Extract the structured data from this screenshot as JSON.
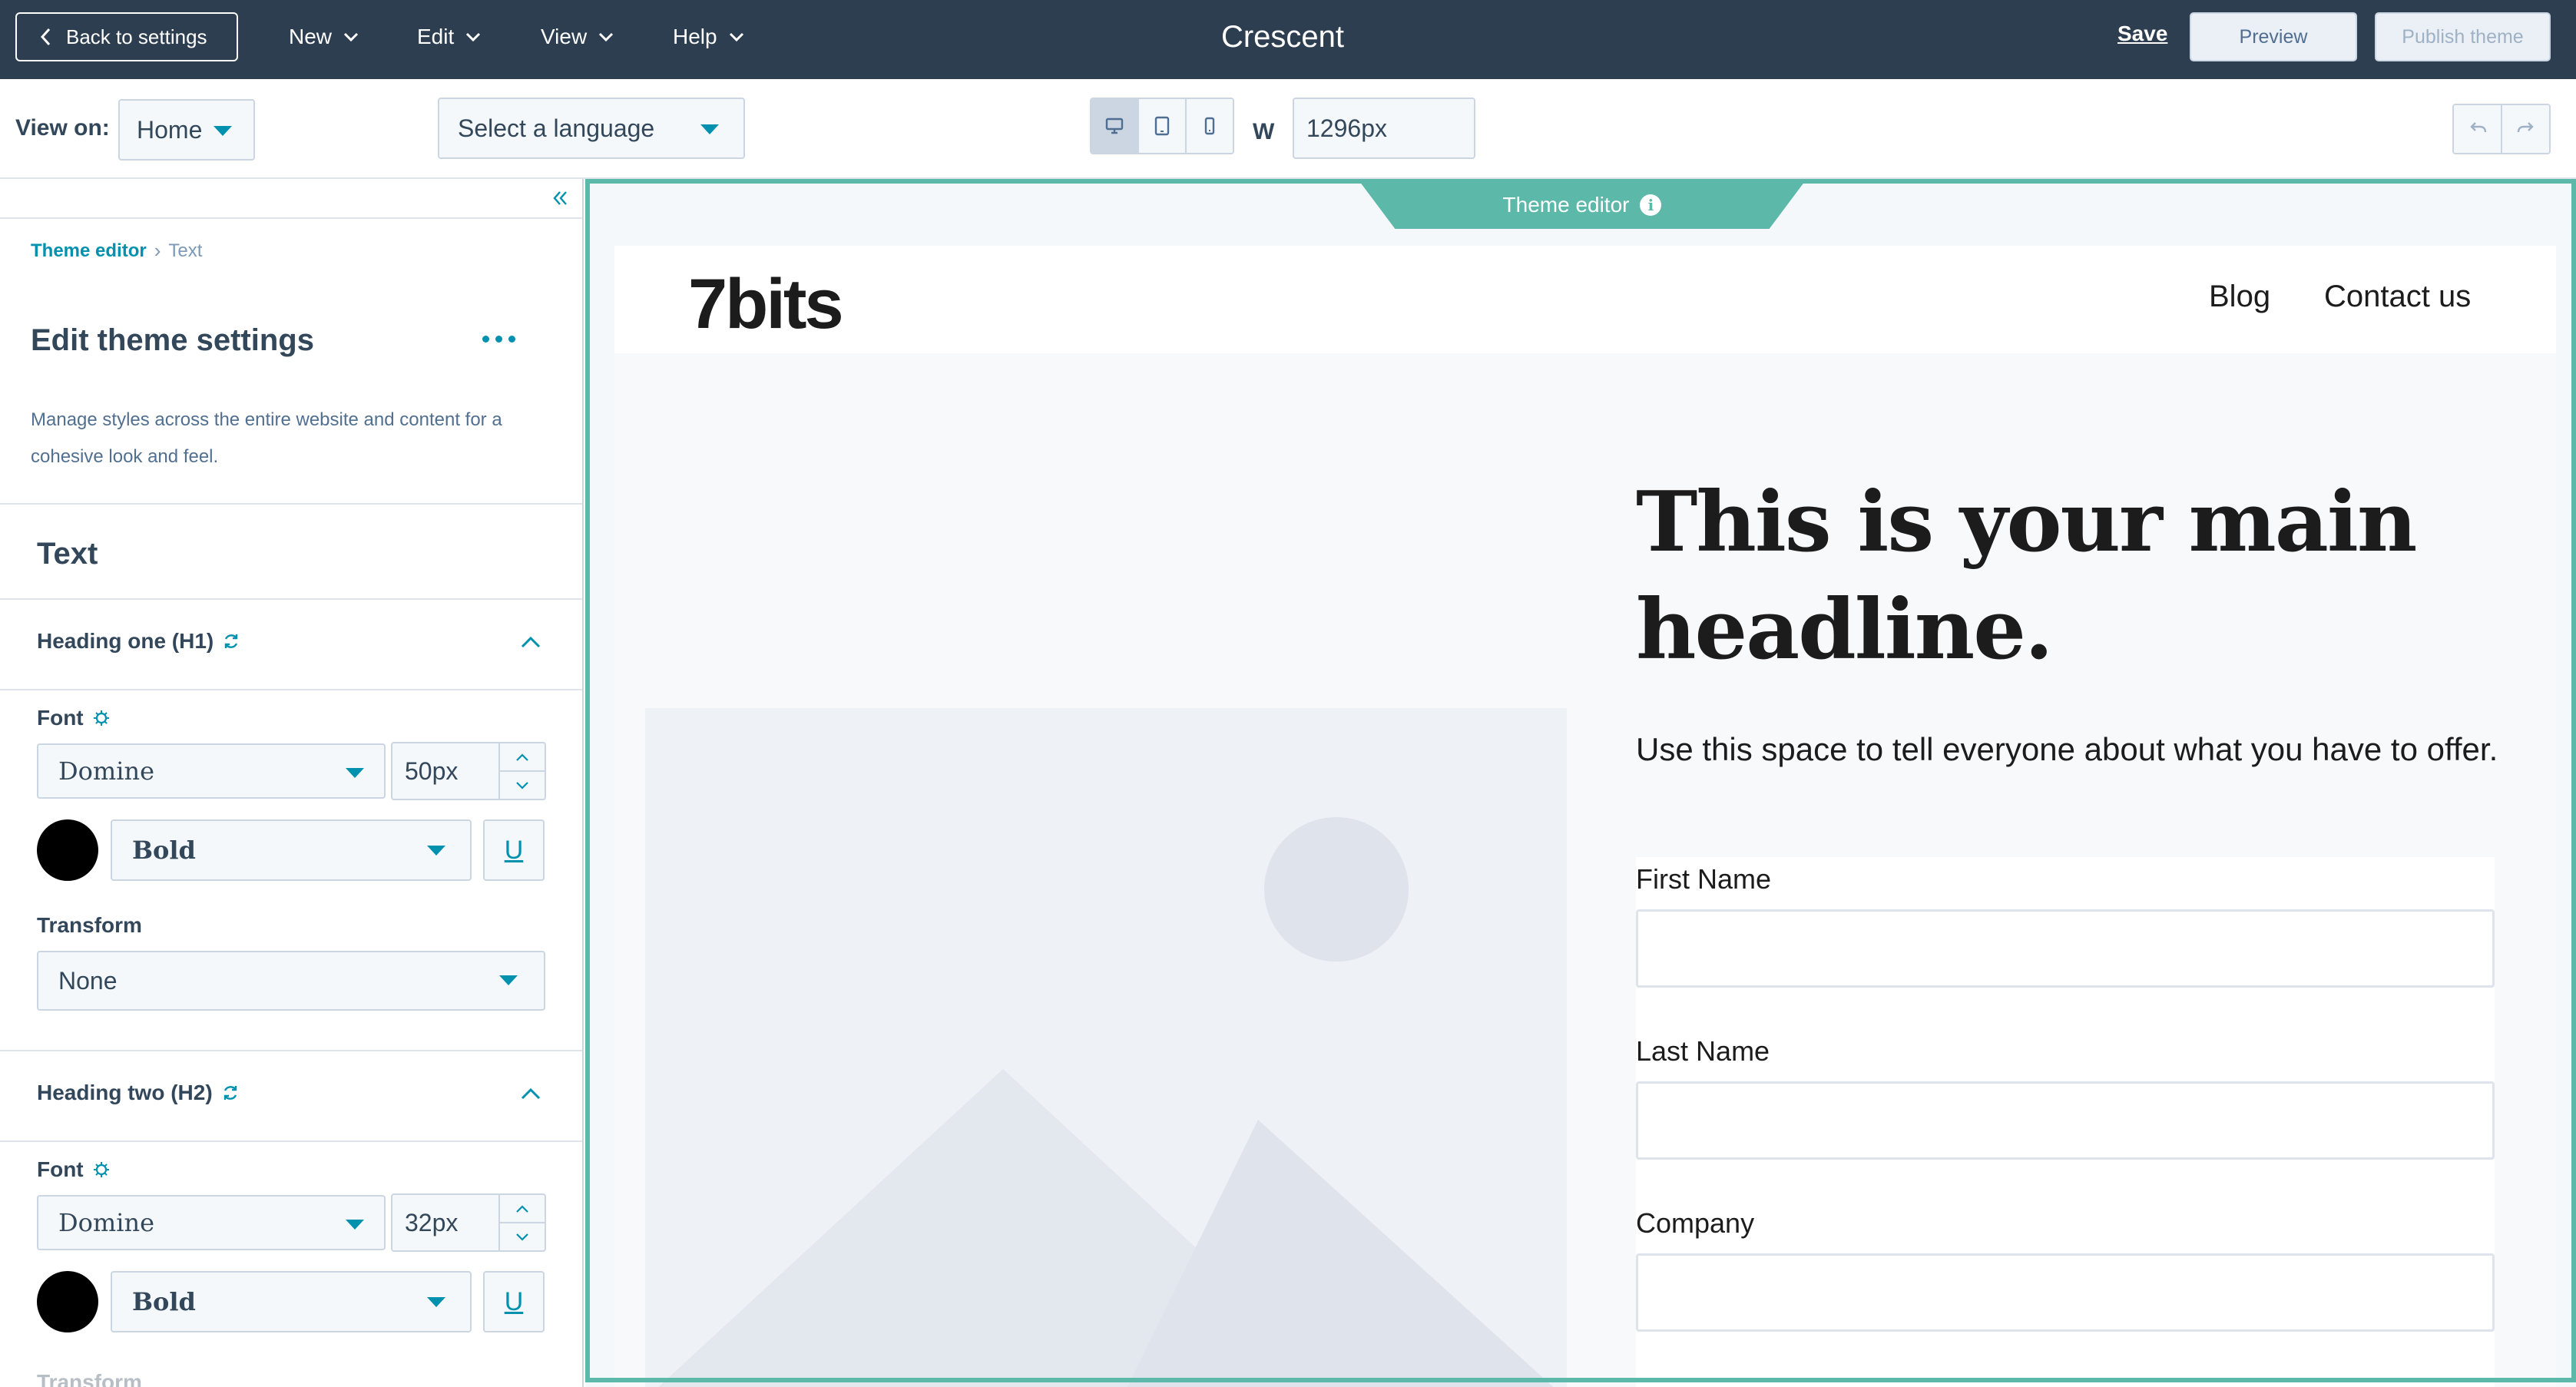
{
  "topbar": {
    "back_label": "Back to settings",
    "menus": [
      {
        "label": "New"
      },
      {
        "label": "Edit"
      },
      {
        "label": "View"
      },
      {
        "label": "Help"
      }
    ],
    "title": "Crescent",
    "save_label": "Save",
    "preview_label": "Preview",
    "publish_label": "Publish theme"
  },
  "toolbar": {
    "view_on_label": "View on:",
    "view_on_value": "Home",
    "language_placeholder": "Select a language",
    "width_label": "W",
    "width_value": "1296px",
    "active_device": "desktop"
  },
  "sidebar": {
    "breadcrumb": {
      "link": "Theme editor",
      "current": "Text"
    },
    "title": "Edit theme settings",
    "description": "Manage styles across the entire website and content for a cohesive look and feel.",
    "section_title": "Text",
    "h1": {
      "heading": "Heading one (H1)",
      "font_label": "Font",
      "font_family": "Domine",
      "font_size": "50px",
      "color": "#000000",
      "weight": "Bold",
      "underline_glyph": "U",
      "transform_label": "Transform",
      "transform_value": "None"
    },
    "h2": {
      "heading": "Heading two (H2)",
      "font_label": "Font",
      "font_family": "Domine",
      "font_size": "32px",
      "color": "#000000",
      "weight": "Bold",
      "underline_glyph": "U",
      "transform_label": "Transform"
    }
  },
  "preview": {
    "tab_label": "Theme editor",
    "logo": "7bits",
    "nav": [
      {
        "label": "Blog"
      },
      {
        "label": "Contact us"
      }
    ],
    "headline": "This is your main headline.",
    "subtext": "Use this space to tell everyone about what you have to offer.",
    "form_fields": [
      {
        "label": "First Name"
      },
      {
        "label": "Last Name"
      },
      {
        "label": "Company"
      }
    ]
  },
  "colors": {
    "topbar_bg": "#2d3e50",
    "accent": "#0091ae",
    "frame": "#5cb8a8"
  }
}
